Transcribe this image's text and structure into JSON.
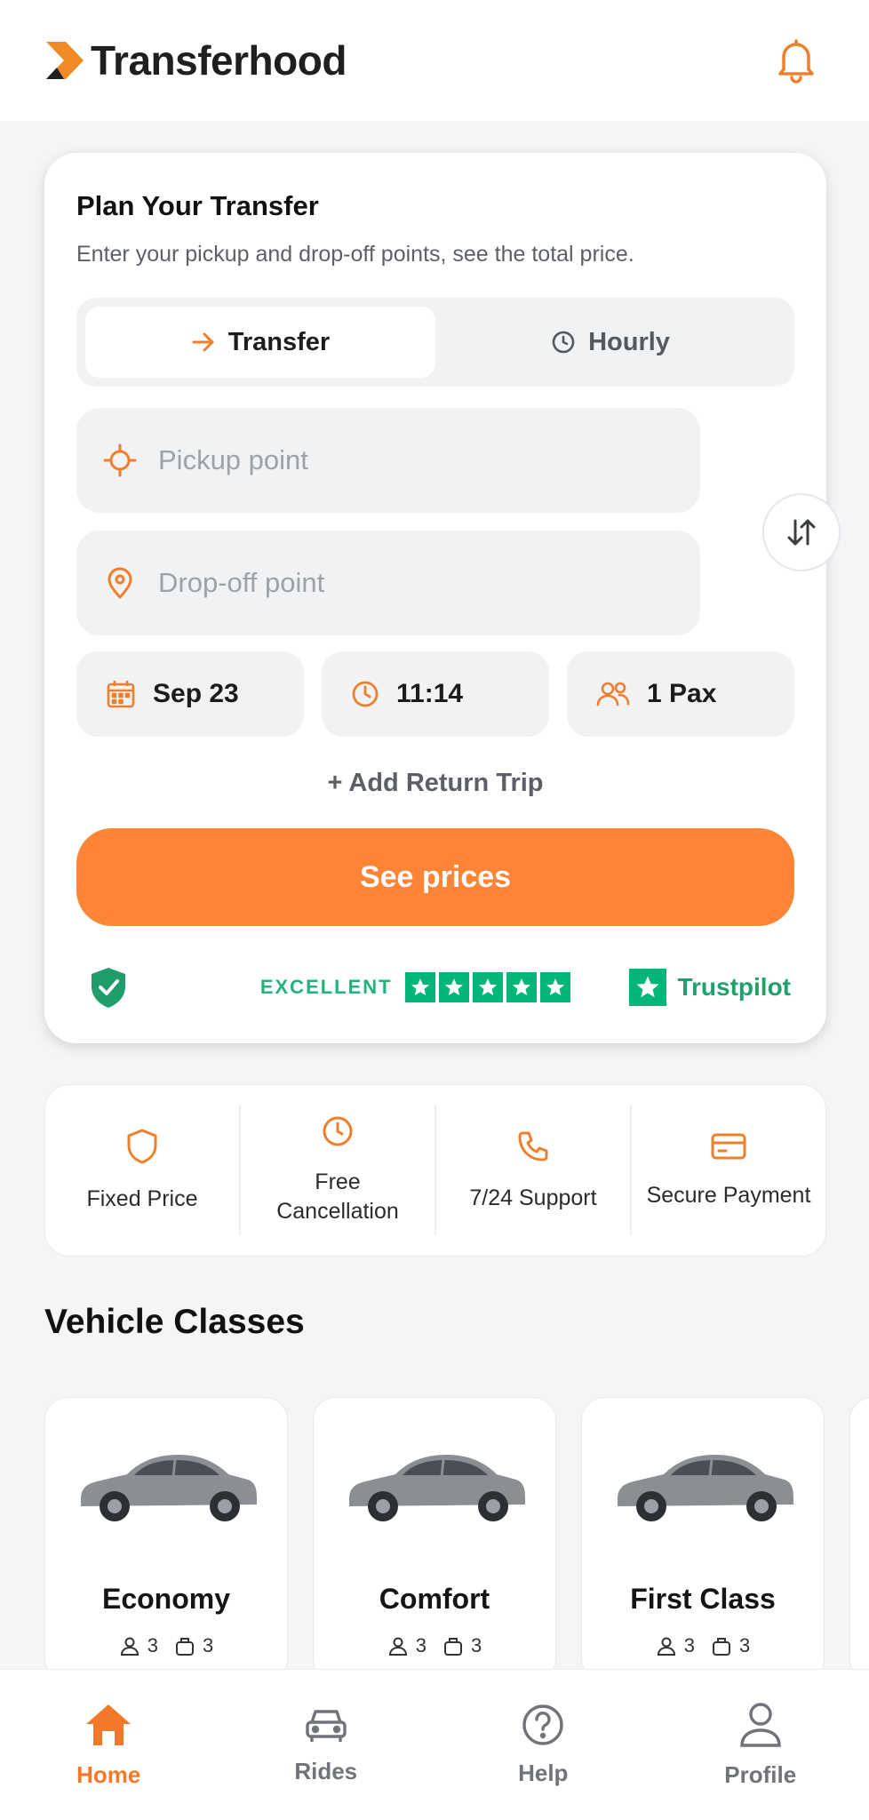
{
  "header": {
    "brand_name": "Transferhood",
    "icons": [
      "transferhood-logo-mark",
      "bell-icon"
    ]
  },
  "plan": {
    "title": "Plan Your Transfer",
    "subtitle": "Enter your pickup and drop-off points, see the total price.",
    "modes": [
      {
        "label": "Transfer",
        "icon": "arrow-right-icon",
        "active": true
      },
      {
        "label": "Hourly",
        "icon": "clock-icon",
        "active": false
      }
    ],
    "pickup_placeholder": "Pickup point",
    "dropoff_placeholder": "Drop-off point",
    "date": "Sep 23",
    "time": "11:14",
    "passengers": "1 Pax",
    "add_return": "+ Add Return Trip",
    "cta": "See prices",
    "trust": {
      "rating_label": "EXCELLENT",
      "stars": 5,
      "provider": "Trustpilot"
    }
  },
  "features": [
    {
      "label": "Fixed Price",
      "icon": "shield-icon"
    },
    {
      "label": "Free Cancellation",
      "icon": "clock-icon"
    },
    {
      "label": "7/24 Support",
      "icon": "phone-icon"
    },
    {
      "label": "Secure Payment",
      "icon": "credit-card-icon"
    }
  ],
  "vehicles": {
    "section_title": "Vehicle Classes",
    "items": [
      {
        "name": "Economy",
        "passengers": "3",
        "luggage": "3"
      },
      {
        "name": "Comfort",
        "passengers": "3",
        "luggage": "3"
      },
      {
        "name": "First Class",
        "passengers": "3",
        "luggage": "3"
      }
    ]
  },
  "nav": [
    {
      "label": "Home",
      "icon": "home-icon",
      "active": true
    },
    {
      "label": "Rides",
      "icon": "car-icon",
      "active": false
    },
    {
      "label": "Help",
      "icon": "help-icon",
      "active": false
    },
    {
      "label": "Profile",
      "icon": "profile-icon",
      "active": false
    }
  ],
  "colors": {
    "accent": "#fd8535",
    "trustpilot_green": "#00b67a",
    "background": "#f4f5f7"
  }
}
